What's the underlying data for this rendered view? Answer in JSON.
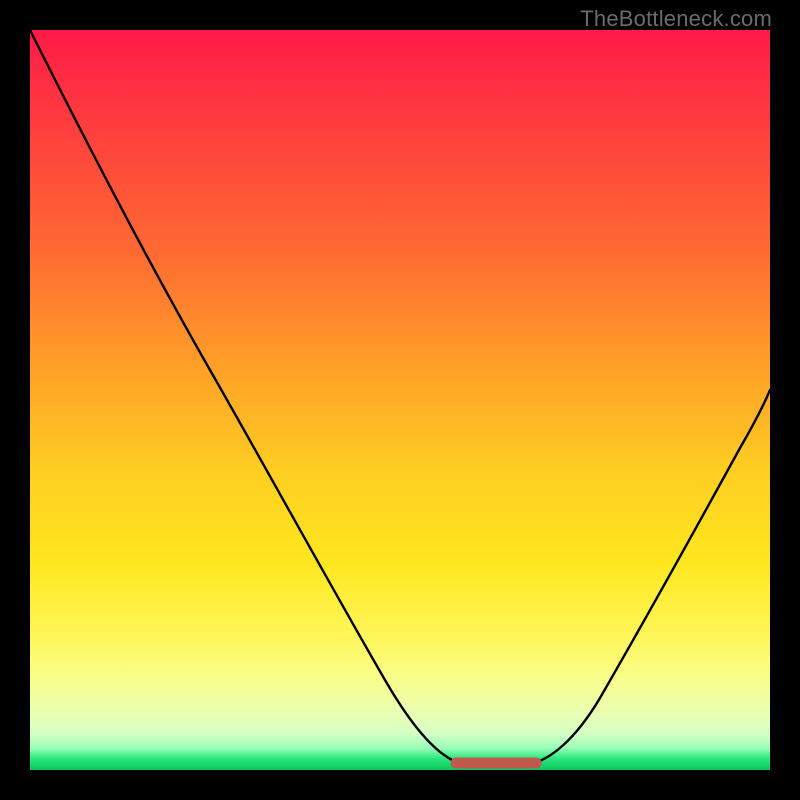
{
  "watermark": {
    "text": "TheBottleneck.com"
  },
  "chart_data": {
    "type": "line",
    "title": "",
    "xlabel": "",
    "ylabel": "",
    "xlim": [
      0,
      100
    ],
    "ylim": [
      0,
      100
    ],
    "grid": false,
    "legend": false,
    "series": [
      {
        "name": "bottleneck-curve",
        "x": [
          0,
          5,
          10,
          15,
          20,
          25,
          30,
          35,
          40,
          45,
          50,
          55,
          58,
          60,
          62,
          65,
          68,
          70,
          72,
          75,
          80,
          85,
          90,
          95,
          100
        ],
        "y": [
          100,
          91,
          82,
          73,
          64,
          55,
          46,
          37,
          28,
          19,
          11,
          4,
          1,
          0,
          0,
          0,
          1,
          3,
          6,
          11,
          20,
          29,
          38,
          47,
          56
        ]
      },
      {
        "name": "optimal-flat-segment",
        "x": [
          58,
          68
        ],
        "y": [
          0.8,
          0.8
        ]
      }
    ],
    "colors": {
      "curve": "#000000",
      "flat_segment": "#c1594f",
      "gradient_top": "#ff1a47",
      "gradient_mid": "#ffcf22",
      "gradient_bottom": "#09c85f"
    },
    "description": "V-shaped bottleneck curve over a vertical red-to-green gradient background; minimum (optimal zone) between ~58 and ~68 on the x-axis, highlighted by a short thick muted-red horizontal segment near y=0."
  }
}
